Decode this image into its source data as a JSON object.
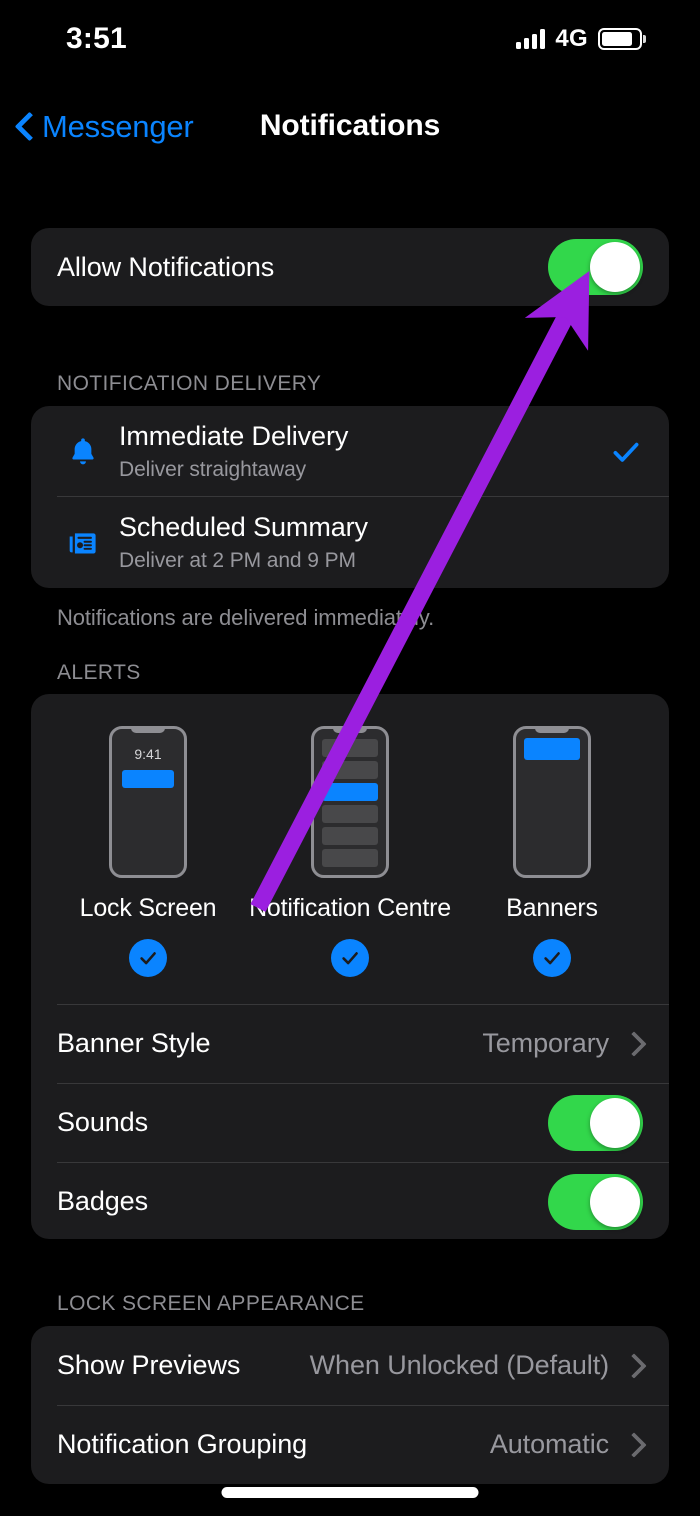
{
  "status_bar": {
    "time": "3:51",
    "network": "4G",
    "signal_icon": "signal-bars-icon",
    "battery_icon": "battery-icon",
    "battery_level_percent": 82
  },
  "nav": {
    "back_label": "Messenger",
    "back_icon": "chevron-left-icon",
    "title": "Notifications"
  },
  "allow": {
    "label": "Allow Notifications",
    "toggle_state": "on"
  },
  "delivery_section": {
    "header": "NOTIFICATION DELIVERY",
    "footer": "Notifications are delivered immediately.",
    "options": [
      {
        "title": "Immediate Delivery",
        "subtitle": "Deliver straightaway",
        "icon": "bell-icon",
        "selected": true,
        "check_icon": "checkmark-icon"
      },
      {
        "title": "Scheduled Summary",
        "subtitle": "Deliver at 2 PM and 9 PM",
        "icon": "newspaper-icon",
        "selected": false
      }
    ]
  },
  "alerts_section": {
    "header": "ALERTS",
    "previews": [
      {
        "label": "Lock Screen",
        "preview_time": "9:41",
        "preview_icon": "lock-screen-preview",
        "checked": true
      },
      {
        "label": "Notification Centre",
        "preview_icon": "notification-centre-preview",
        "checked": true
      },
      {
        "label": "Banners",
        "preview_icon": "banners-preview",
        "checked": true
      }
    ],
    "rows": [
      {
        "label": "Banner Style",
        "value": "Temporary",
        "type": "disclosure"
      },
      {
        "label": "Sounds",
        "value": "on",
        "type": "toggle"
      },
      {
        "label": "Badges",
        "value": "on",
        "type": "toggle"
      }
    ]
  },
  "lock_screen_section": {
    "header": "LOCK SCREEN APPEARANCE",
    "rows": [
      {
        "label": "Show Previews",
        "value": "When Unlocked (Default)"
      },
      {
        "label": "Notification Grouping",
        "value": "Automatic"
      }
    ]
  },
  "annotation": {
    "arrow_icon": "purple-arrow-annotation",
    "color": "#9b1fe0",
    "points_to": "allow-notifications-toggle"
  },
  "colors": {
    "background": "#000000",
    "card": "#1c1c1e",
    "accent_blue": "#0a84ff",
    "toggle_green": "#32d74b",
    "secondary_text": "#98989e",
    "annotation_purple": "#9b1fe0"
  }
}
